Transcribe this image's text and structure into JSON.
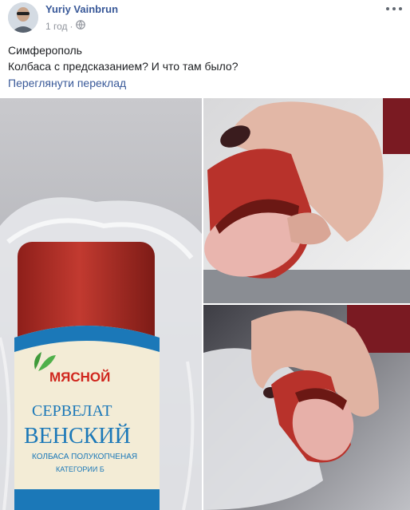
{
  "post": {
    "author": "Yuriy Vainbrun",
    "time": "1 год",
    "privacy_icon": "globe-icon",
    "more_icon": "more-dots-icon",
    "text_lines": [
      "Симферополь",
      "Колбаса с предсказанием? И что там было?"
    ],
    "translate_link": "Переглянути переклад"
  },
  "photos": [
    {
      "label": {
        "brand": "МЯСНОЙ",
        "product_line1": "СЕРВЕЛАТ",
        "product_line2": "ВЕНСКИЙ",
        "subtitle": "КОЛБАСА ПОЛУКОПЧЕНАЯ",
        "category": "КАТЕГОРИИ Б"
      }
    },
    {},
    {}
  ],
  "colors": {
    "link": "#385898",
    "meta": "#90949c",
    "sausage": "#b8322b",
    "label_blue": "#1b78b8"
  }
}
